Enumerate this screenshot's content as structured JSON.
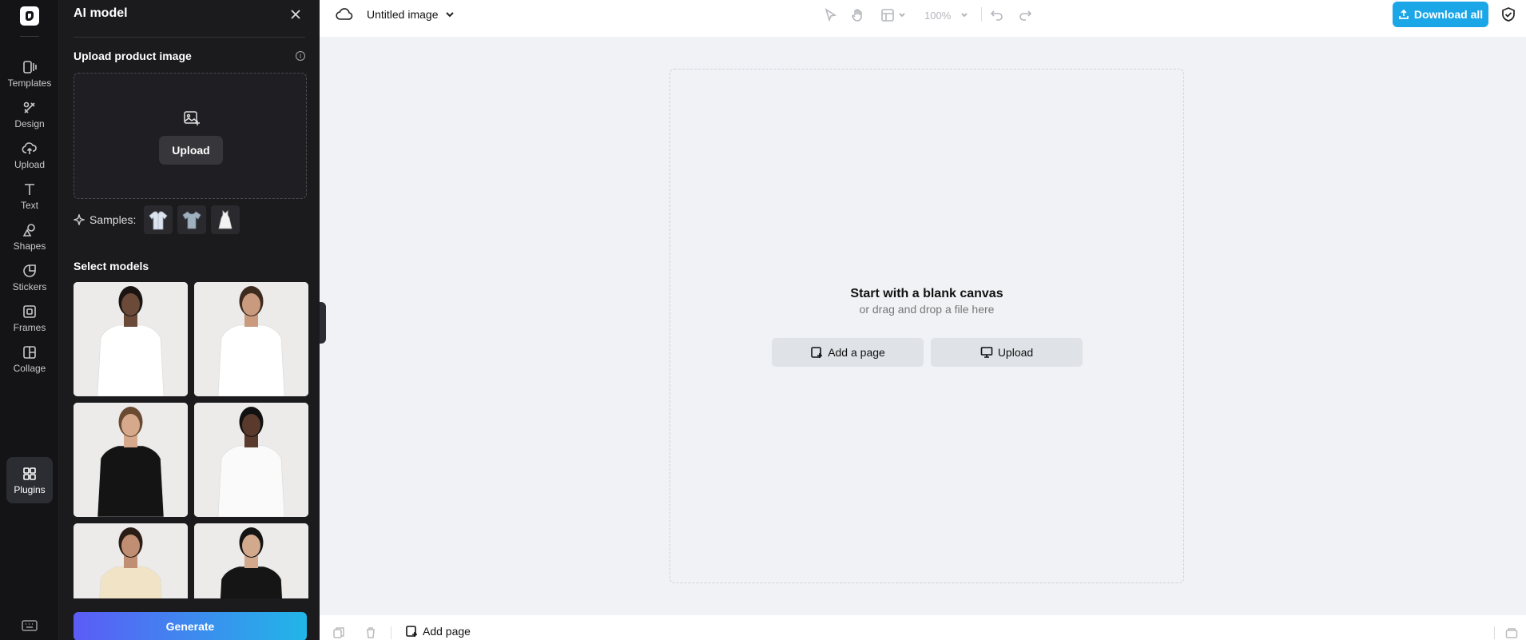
{
  "rail": {
    "logo": "app-logo",
    "items": [
      {
        "label": "Templates",
        "icon": "templates-icon"
      },
      {
        "label": "Design",
        "icon": "design-icon"
      },
      {
        "label": "Upload",
        "icon": "upload-icon"
      },
      {
        "label": "Text",
        "icon": "text-icon"
      },
      {
        "label": "Shapes",
        "icon": "shapes-icon"
      },
      {
        "label": "Stickers",
        "icon": "stickers-icon"
      },
      {
        "label": "Frames",
        "icon": "frames-icon"
      },
      {
        "label": "Collage",
        "icon": "collage-icon"
      },
      {
        "label": "Plugins",
        "icon": "plugins-icon"
      }
    ],
    "active": "Plugins",
    "bottom_icon": "keyboard-icon"
  },
  "panel": {
    "title": "AI model",
    "upload_section_title": "Upload product image",
    "upload_button": "Upload",
    "samples_label": "Samples:",
    "samples": [
      "shirt-sample",
      "tshirt-sample",
      "dress-sample"
    ],
    "models_title": "Select models",
    "models": [
      {
        "name": "model-1",
        "top": "white tank top",
        "skin": "#6b4a3a",
        "hair": "#1a1512",
        "shirt": "#ffffff",
        "pants": "#2e3a4f"
      },
      {
        "name": "model-2",
        "top": "white tank top",
        "skin": "#c99a7e",
        "hair": "#3d2b20",
        "shirt": "#ffffff",
        "pants": "#ecebea"
      },
      {
        "name": "model-3",
        "top": "black long sleeve",
        "skin": "#d7a98c",
        "hair": "#6a4a30",
        "shirt": "#141414",
        "pants": "#ecebea"
      },
      {
        "name": "model-4",
        "top": "white t-shirt",
        "skin": "#5a3a2c",
        "hair": "#111111",
        "shirt": "#fafafa",
        "pants": "#ecebea"
      },
      {
        "name": "model-5",
        "top": "cream t-shirt",
        "skin": "#c08e72",
        "hair": "#2a1d16",
        "shirt": "#f1e3c6",
        "pants": "#ecebea"
      },
      {
        "name": "model-6",
        "top": "black t-shirt",
        "skin": "#d3a98e",
        "hair": "#141414",
        "shirt": "#151515",
        "pants": "#ecebea"
      }
    ],
    "generate_button": "Generate"
  },
  "topbar": {
    "doc_title": "Untitled image",
    "zoom": "100%",
    "download_button": "Download all",
    "accent": "#1ba6e8"
  },
  "canvas": {
    "heading": "Start with a blank canvas",
    "subheading": "or drag and drop a file here",
    "add_page_button": "Add a page",
    "upload_button": "Upload"
  },
  "bottombar": {
    "add_page": "Add page"
  }
}
